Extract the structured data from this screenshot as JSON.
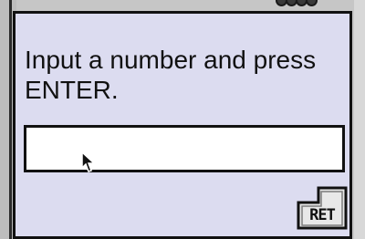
{
  "dialog": {
    "prompt": "Input a number and press\nENTER.",
    "input_value": "",
    "input_placeholder": ""
  },
  "ret_key": {
    "label": "RET",
    "icon": "return-key-icon"
  },
  "cursor": {
    "icon": "mouse-pointer-icon"
  },
  "colors": {
    "dialog_bg": "#dcdcf0",
    "border": "#111111",
    "input_bg": "#ffffff"
  }
}
